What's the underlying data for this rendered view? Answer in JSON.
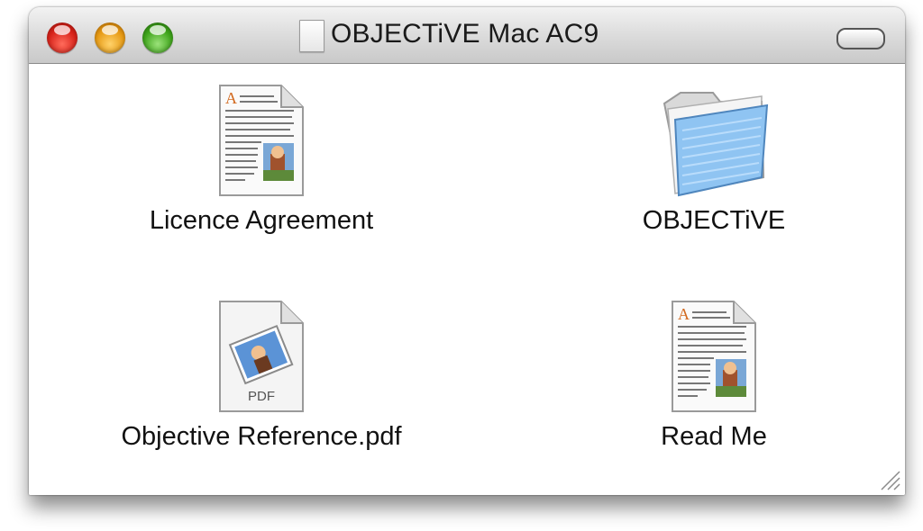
{
  "window": {
    "title": "OBJECTiVE Mac AC9"
  },
  "items": [
    {
      "label": "Licence Agreement",
      "kind": "text-document-icon"
    },
    {
      "label": "OBJECTiVE",
      "kind": "folder-icon"
    },
    {
      "label": "Objective Reference.pdf",
      "kind": "pdf-document-icon",
      "badge": "PDF"
    },
    {
      "label": "Read Me",
      "kind": "text-document-icon"
    }
  ],
  "colors": {
    "close": "#d8231a",
    "minimize": "#e79a14",
    "zoom": "#3fa51b",
    "folder": "#8fc4f2"
  }
}
